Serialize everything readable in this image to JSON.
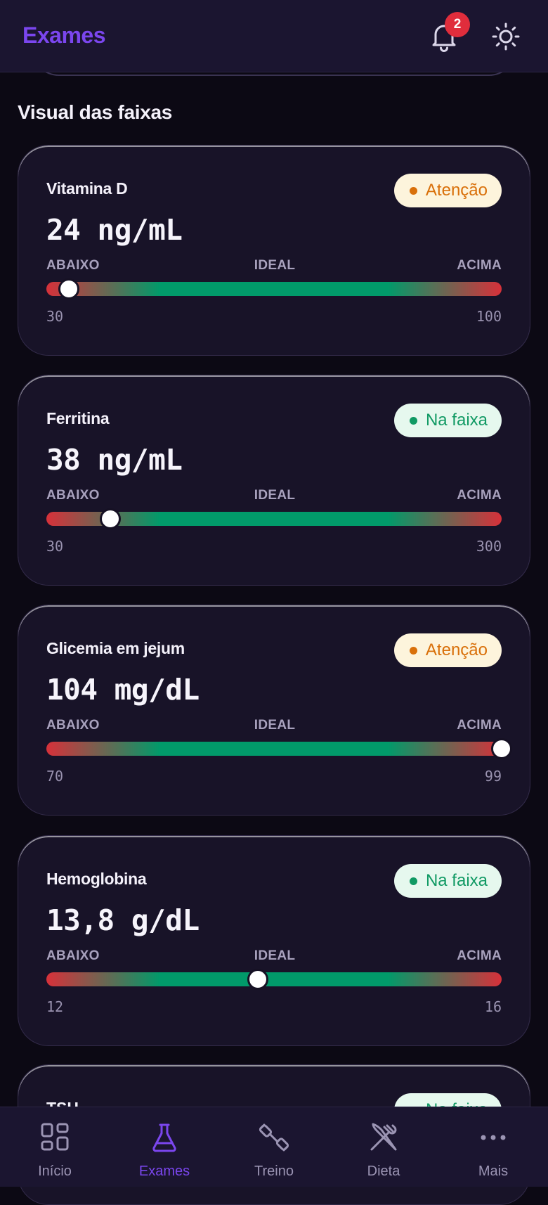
{
  "header": {
    "title": "Exames",
    "notification_count": "2"
  },
  "section_title": "Visual das faixas",
  "zone_labels": {
    "low": "ABAIXO",
    "ideal": "IDEAL",
    "high": "ACIMA"
  },
  "cards": [
    {
      "name": "Vitamina D",
      "value": "24 ng/mL",
      "status": "Atenção",
      "status_type": "warn",
      "min": "30",
      "max": "100",
      "marker_fraction": 0.05
    },
    {
      "name": "Ferritina",
      "value": "38 ng/mL",
      "status": "Na faixa",
      "status_type": "ok",
      "min": "30",
      "max": "300",
      "marker_fraction": 0.14
    },
    {
      "name": "Glicemia em jejum",
      "value": "104 mg/dL",
      "status": "Atenção",
      "status_type": "warn",
      "min": "70",
      "max": "99",
      "marker_fraction": 1.0
    },
    {
      "name": "Hemoglobina",
      "value": "13,8 g/dL",
      "status": "Na faixa",
      "status_type": "ok",
      "min": "12",
      "max": "16",
      "marker_fraction": 0.465
    }
  ],
  "partial_card": {
    "name": "TSH",
    "status": "Na faixa"
  },
  "nav": {
    "items": [
      {
        "label": "Início",
        "icon": "grid-icon"
      },
      {
        "label": "Exames",
        "icon": "flask-icon"
      },
      {
        "label": "Treino",
        "icon": "dumbbell-icon"
      },
      {
        "label": "Dieta",
        "icon": "fork-knife-icon"
      },
      {
        "label": "Mais",
        "icon": "more-icon"
      }
    ],
    "active_index": 1
  },
  "colors": {
    "accent": "#7b46ee",
    "warn": "#d9700a",
    "ok": "#0f9a63",
    "badge": "#e02d3c"
  }
}
